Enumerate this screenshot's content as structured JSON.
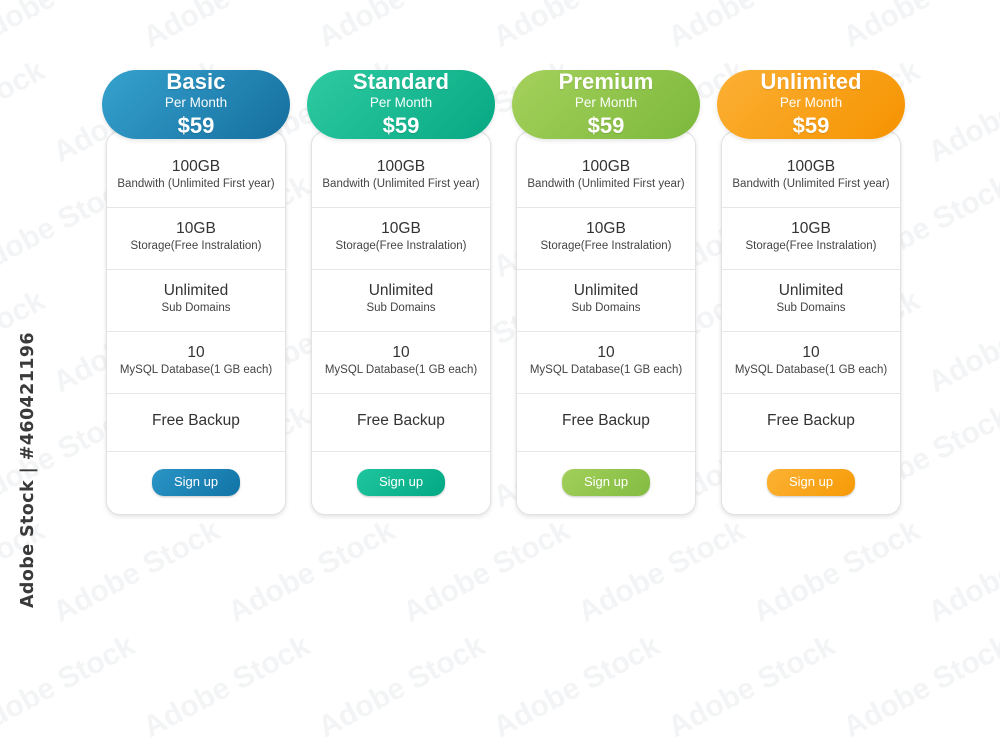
{
  "watermark": {
    "label": "Adobe Stock | #460421196",
    "tile_text": "Adobe Stock"
  },
  "pricing": {
    "plans": [
      {
        "name": "Basic",
        "period": "Per Month",
        "price": "$59",
        "accent": "#1D82B4",
        "header_gradient_from": "#36A2CE",
        "header_gradient_to": "#156E9E",
        "button_gradient_from": "#2A95C6",
        "button_gradient_to": "#1173A6",
        "button_label": "Sign up",
        "features": [
          {
            "main": "100GB",
            "sub": "Bandwith (Unlimited First year)"
          },
          {
            "main": "10GB",
            "sub": "Storage(Free Instralation)"
          },
          {
            "main": "Unlimited",
            "sub": "Sub Domains"
          },
          {
            "main": "10",
            "sub": "MySQL Database(1 GB each)"
          },
          {
            "main": "Free Backup",
            "sub": ""
          }
        ]
      },
      {
        "name": "Standard",
        "period": "Per Month",
        "price": "$59",
        "accent": "#16B793",
        "header_gradient_from": "#2FCBA2",
        "header_gradient_to": "#06A883",
        "button_gradient_from": "#1EC69E",
        "button_gradient_to": "#03A884",
        "button_label": "Sign up",
        "features": [
          {
            "main": "100GB",
            "sub": "Bandwith (Unlimited First year)"
          },
          {
            "main": "10GB",
            "sub": "Storage(Free Instralation)"
          },
          {
            "main": "Unlimited",
            "sub": "Sub Domains"
          },
          {
            "main": "10",
            "sub": "MySQL Database(1 GB each)"
          },
          {
            "main": "Free Backup",
            "sub": ""
          }
        ]
      },
      {
        "name": "Premium",
        "period": "Per Month",
        "price": "$59",
        "accent": "#90C64B",
        "header_gradient_from": "#A5D15C",
        "header_gradient_to": "#7CB83C",
        "button_gradient_from": "#A2CF5A",
        "button_gradient_to": "#83BC42",
        "button_label": "Sign up",
        "features": [
          {
            "main": "100GB",
            "sub": "Bandwith (Unlimited First year)"
          },
          {
            "main": "10GB",
            "sub": "Storage(Free Instralation)"
          },
          {
            "main": "Unlimited",
            "sub": "Sub Domains"
          },
          {
            "main": "10",
            "sub": "MySQL Database(1 GB each)"
          },
          {
            "main": "Free Backup",
            "sub": ""
          }
        ]
      },
      {
        "name": "Unlimited",
        "period": "Per Month",
        "price": "$59",
        "accent": "#F7A21B",
        "header_gradient_from": "#FCB035",
        "header_gradient_to": "#F59300",
        "button_gradient_from": "#FCB234",
        "button_gradient_to": "#F69A07",
        "button_label": "Sign up",
        "features": [
          {
            "main": "100GB",
            "sub": "Bandwith (Unlimited First year)"
          },
          {
            "main": "10GB",
            "sub": "Storage(Free Instralation)"
          },
          {
            "main": "Unlimited",
            "sub": "Sub Domains"
          },
          {
            "main": "10",
            "sub": "MySQL Database(1 GB each)"
          },
          {
            "main": "Free Backup",
            "sub": ""
          }
        ]
      }
    ]
  }
}
